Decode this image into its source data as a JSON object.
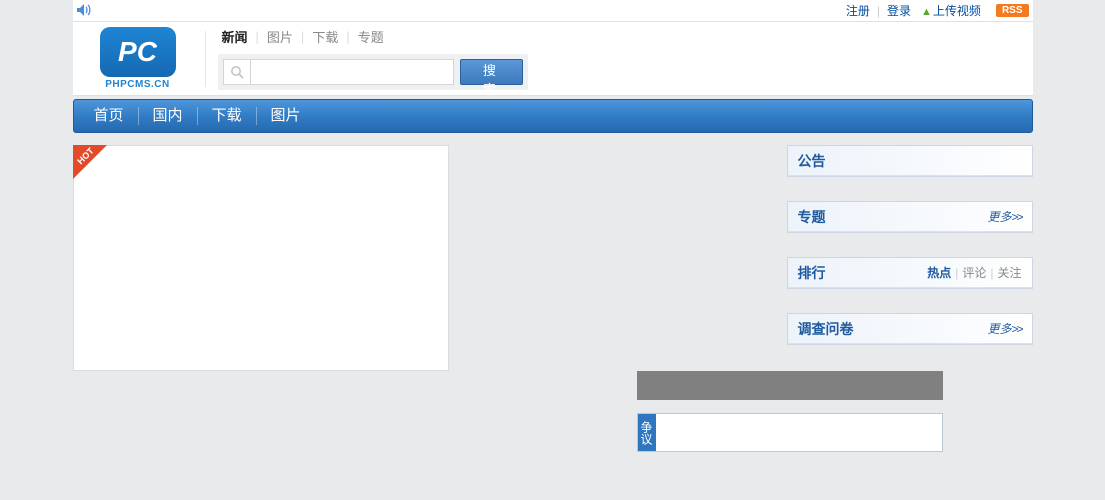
{
  "topbar": {
    "register": "注册",
    "login": "登录",
    "upload": "上传视频",
    "rss": "RSS"
  },
  "logo": {
    "mark": "PC",
    "text": "PHPCMS.CN"
  },
  "subnav": {
    "items": [
      "新闻",
      "图片",
      "下载",
      "专题"
    ],
    "active_index": 0
  },
  "search": {
    "placeholder": "",
    "button": "搜 索"
  },
  "nav": {
    "items": [
      "首页",
      "国内",
      "下载",
      "图片"
    ]
  },
  "hot": {
    "ribbon": "HOT"
  },
  "debate": {
    "label": "争议"
  },
  "sidebar": {
    "notice": {
      "title": "公告"
    },
    "special": {
      "title": "专题",
      "more": "更多"
    },
    "rank": {
      "title": "排行",
      "tabs": [
        "热点",
        "评论",
        "关注"
      ],
      "active_index": 0
    },
    "survey": {
      "title": "调查问卷",
      "more": "更多"
    }
  }
}
